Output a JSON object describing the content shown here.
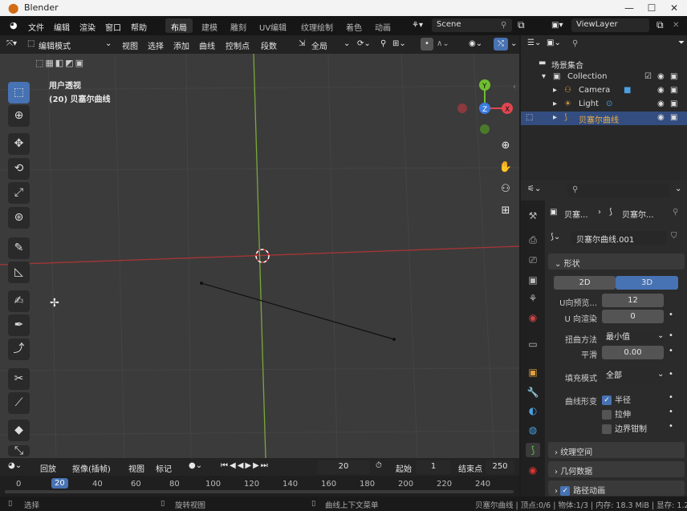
{
  "window": {
    "app_title": "Blender",
    "minimize": "—",
    "maximize": "☐",
    "close": "✕"
  },
  "menu": {
    "items": [
      "文件",
      "编辑",
      "渲染",
      "窗口",
      "帮助"
    ],
    "workspaces": [
      "布局",
      "建模",
      "雕刻",
      "UV编辑",
      "纹理绘制",
      "着色",
      "动画"
    ],
    "scene": "Scene",
    "view_layer": "ViewLayer"
  },
  "header3d": {
    "mode": "编辑模式",
    "menus": [
      "视图",
      "选择",
      "添加",
      "曲线",
      "控制点",
      "段数"
    ],
    "transform": "全局"
  },
  "viewport": {
    "view_name": "用户透视",
    "object_label": "(20) 贝塞尔曲线"
  },
  "gizmo": {
    "x": "X",
    "y": "Y",
    "z": "Z"
  },
  "timeline": {
    "playback": "回放",
    "keying": "抠像(插帧)",
    "view": "视图",
    "marker": "标记",
    "current_frame": "20",
    "start_label": "起始",
    "start": "1",
    "end_label": "结束点",
    "end": "250"
  },
  "frames": {
    "numbers": [
      "0",
      "20",
      "40",
      "60",
      "80",
      "100",
      "120",
      "140",
      "160",
      "180",
      "200",
      "220",
      "240"
    ]
  },
  "statusbar": {
    "select": "选择",
    "rotate": "旋转视图",
    "context": "曲线上下文菜单",
    "info": "贝塞尔曲线 | 顶点:0/6 | 物体:1/3 | 内存: 18.3 MiB | 显存: 1.2/"
  },
  "outliner": {
    "root": "场景集合",
    "collection": "Collection",
    "items": [
      "Camera",
      "Light",
      "贝塞尔曲线"
    ]
  },
  "properties": {
    "breadcrumb_a": "贝塞...",
    "breadcrumb_b": "贝塞尔...",
    "datablock": "贝塞尔曲线.001",
    "shape_section": "形状",
    "btn_2d": "2D",
    "btn_3d": "3D",
    "u_preview_label": "U向预览...",
    "u_preview": "12",
    "u_render_label": "U 向渲染",
    "u_render": "0",
    "twist_label": "扭曲方法",
    "twist": "最小值",
    "smooth_label": "平滑",
    "smooth": "0.00",
    "fill_label": "填充模式",
    "fill": "全部",
    "deform_label": "曲线形变",
    "radius": "半径",
    "stretch": "拉伸",
    "clamp": "边界钳制",
    "texture_space": "纹理空间",
    "geometry": "几何数据",
    "path_anim": "路径动画"
  },
  "colors": {
    "accent": "#4772b3",
    "x_axis": "#e0474f",
    "y_axis": "#6fbe30",
    "z_axis": "#3b7ce0",
    "selected_row": "#334d80"
  }
}
